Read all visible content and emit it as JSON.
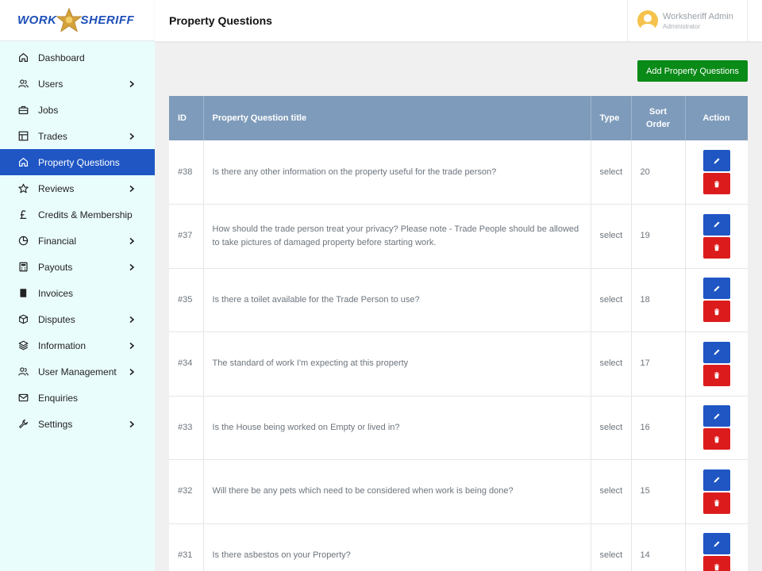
{
  "brand": {
    "logo_left": "WORK",
    "logo_right": "SHERIFF"
  },
  "header": {
    "title": "Property Questions"
  },
  "user": {
    "name": "Worksheriff Admin",
    "role": "Administrator"
  },
  "sidebar": {
    "items": [
      {
        "label": "Dashboard",
        "icon": "home-icon",
        "chevron": false
      },
      {
        "label": "Users",
        "icon": "users-icon",
        "chevron": true
      },
      {
        "label": "Jobs",
        "icon": "briefcase-icon",
        "chevron": false
      },
      {
        "label": "Trades",
        "icon": "layout-icon",
        "chevron": true
      },
      {
        "label": "Property Questions",
        "icon": "home-icon",
        "chevron": false,
        "active": true
      },
      {
        "label": "Reviews",
        "icon": "star-icon",
        "chevron": true
      },
      {
        "label": "Credits & Membership",
        "icon": "pound-icon",
        "chevron": false
      },
      {
        "label": "Financial",
        "icon": "pie-chart-icon",
        "chevron": true
      },
      {
        "label": "Payouts",
        "icon": "calculator-icon",
        "chevron": true
      },
      {
        "label": "Invoices",
        "icon": "book-icon",
        "chevron": false
      },
      {
        "label": "Disputes",
        "icon": "box-icon",
        "chevron": true
      },
      {
        "label": "Information",
        "icon": "layers-icon",
        "chevron": true
      },
      {
        "label": "User Management",
        "icon": "users-icon",
        "chevron": true
      },
      {
        "label": "Enquiries",
        "icon": "mail-icon",
        "chevron": false
      },
      {
        "label": "Settings",
        "icon": "tool-icon",
        "chevron": true
      }
    ]
  },
  "actions": {
    "add_label": "Add Property Questions"
  },
  "table": {
    "headers": {
      "id": "ID",
      "title": "Property Question title",
      "type": "Type",
      "sort": "Sort Order",
      "action": "Action"
    },
    "rows": [
      {
        "id": "#38",
        "title": "Is there any other information on the property useful for the trade person?",
        "type": "select",
        "sort": "20"
      },
      {
        "id": "#37",
        "title": "How should the trade person treat your privacy? Please note - Trade People should be allowed to take pictures of damaged property before starting work.",
        "type": "select",
        "sort": "19"
      },
      {
        "id": "#35",
        "title": "Is there a toilet available for the Trade Person to use?",
        "type": "select",
        "sort": "18"
      },
      {
        "id": "#34",
        "title": "The standard of work I'm expecting at this property",
        "type": "select",
        "sort": "17"
      },
      {
        "id": "#33",
        "title": "Is the House being worked on Empty or lived in?",
        "type": "select",
        "sort": "16"
      },
      {
        "id": "#32",
        "title": "Will there be any pets which need to be considered when work is being done?",
        "type": "select",
        "sort": "15"
      },
      {
        "id": "#31",
        "title": "Is there asbestos on your Property?",
        "type": "select",
        "sort": "14"
      }
    ]
  },
  "colors": {
    "accent": "#1f56c4",
    "success": "#0a8a17",
    "danger": "#dc1c1c",
    "table_header": "#7e9bbb",
    "sidebar_bg": "#eafdfd"
  }
}
